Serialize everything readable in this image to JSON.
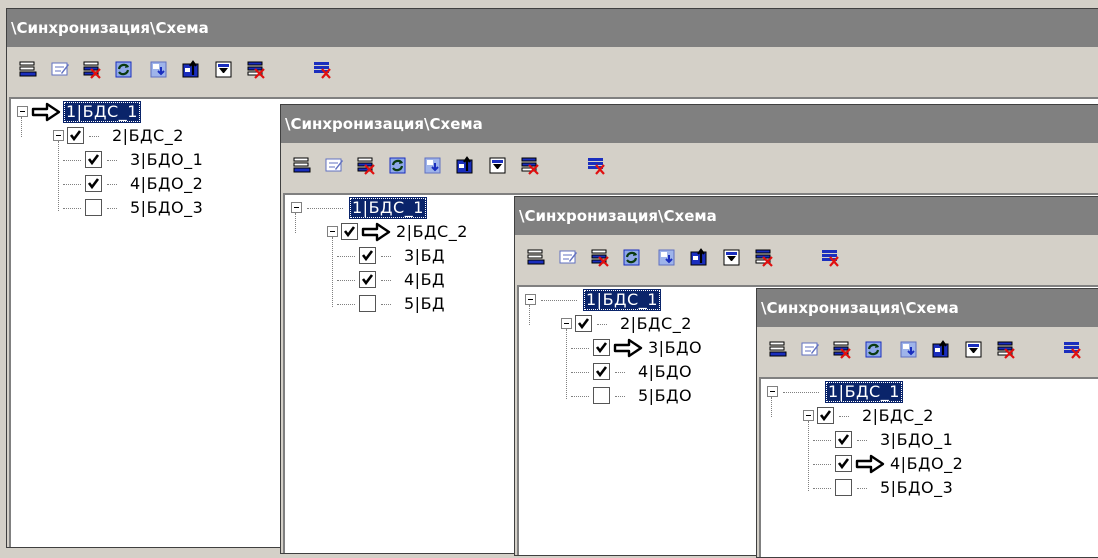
{
  "window": {
    "title": "\\Синхронизация\\Схема"
  },
  "toolbar": {
    "buttons": [
      {
        "name": "tb-list-icon"
      },
      {
        "name": "tb-edit-icon"
      },
      {
        "name": "tb-delete-row-icon"
      },
      {
        "name": "tb-refresh-icon"
      },
      {
        "name": "tb-import-icon"
      },
      {
        "name": "tb-export-icon"
      },
      {
        "name": "tb-filter-icon"
      },
      {
        "name": "tb-clear-filter-icon"
      },
      {
        "name": "tb-delete-all-icon"
      }
    ]
  },
  "panels": [
    {
      "title": "\\Синхронизация\\Схема",
      "arrow_on": 0,
      "nodes": [
        {
          "label": "1|БДС_1",
          "selected": true,
          "checkbox": false
        },
        {
          "label": "2|БДС_2",
          "selected": false,
          "checkbox": true,
          "checked": true
        },
        {
          "label": "3|БДО_1",
          "selected": false,
          "checkbox": true,
          "checked": true
        },
        {
          "label": "4|БДО_2",
          "selected": false,
          "checkbox": true,
          "checked": true
        },
        {
          "label": "5|БДО_3",
          "selected": false,
          "checkbox": true,
          "checked": false
        }
      ]
    },
    {
      "title": "\\Синхронизация\\Схема",
      "arrow_on": 1,
      "nodes": [
        {
          "label": "1|БДС_1",
          "selected": true,
          "checkbox": false
        },
        {
          "label": "2|БДС_2",
          "selected": false,
          "checkbox": true,
          "checked": true
        },
        {
          "label": "3|БД",
          "selected": false,
          "checkbox": true,
          "checked": true
        },
        {
          "label": "4|БД",
          "selected": false,
          "checkbox": true,
          "checked": true
        },
        {
          "label": "5|БД",
          "selected": false,
          "checkbox": true,
          "checked": false
        }
      ]
    },
    {
      "title": "\\Синхронизация\\Схема",
      "arrow_on": 2,
      "nodes": [
        {
          "label": "1|БДС_1",
          "selected": true,
          "checkbox": false
        },
        {
          "label": "2|БДС_2",
          "selected": false,
          "checkbox": true,
          "checked": true
        },
        {
          "label": "3|БДО",
          "selected": false,
          "checkbox": true,
          "checked": true
        },
        {
          "label": "4|БДО",
          "selected": false,
          "checkbox": true,
          "checked": true
        },
        {
          "label": "5|БДО",
          "selected": false,
          "checkbox": true,
          "checked": false
        }
      ]
    },
    {
      "title": "\\Синхронизация\\Схема",
      "arrow_on": 3,
      "nodes": [
        {
          "label": "1|БДС_1",
          "selected": true,
          "checkbox": false
        },
        {
          "label": "2|БДС_2",
          "selected": false,
          "checkbox": true,
          "checked": true
        },
        {
          "label": "3|БДО_1",
          "selected": false,
          "checkbox": true,
          "checked": true
        },
        {
          "label": "4|БДО_2",
          "selected": false,
          "checkbox": true,
          "checked": true
        },
        {
          "label": "5|БДО_3",
          "selected": false,
          "checkbox": true,
          "checked": false
        }
      ]
    }
  ],
  "colors": {
    "selection": "#0a246a",
    "titlebar": "#808080",
    "face": "#d4d0c8"
  }
}
